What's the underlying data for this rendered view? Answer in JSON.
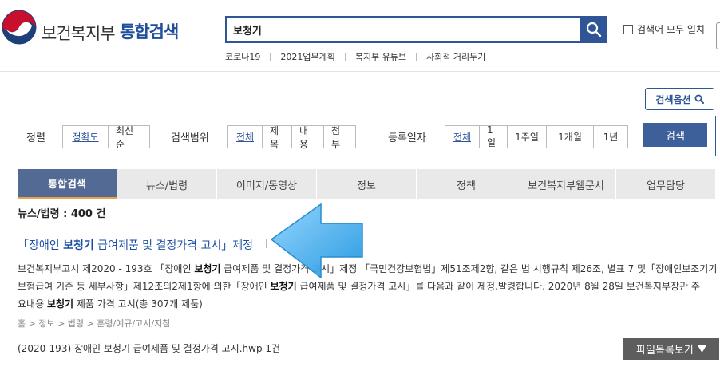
{
  "header": {
    "brand": "보건복지부",
    "service": "통합검색",
    "search_value": "보청기",
    "exact_match_label": "검색어 모두 일치",
    "quicklinks": [
      "코로나19",
      "2021업무계획",
      "복지부 유튜브",
      "사회적 거리두기"
    ]
  },
  "options_button": "검색옵션",
  "filters": {
    "sort_label": "정렬",
    "sort_options": [
      "정확도",
      "최신순"
    ],
    "scope_label": "검색범위",
    "scope_options": [
      "전체",
      "제목",
      "내용",
      "첨부"
    ],
    "date_label": "등록일자",
    "date_options": [
      "전체",
      "1일",
      "1주일",
      "1개월",
      "1년"
    ],
    "search_button": "검색"
  },
  "tabs": [
    "통합검색",
    "뉴스/법령",
    "이미지/동영상",
    "정보",
    "정책",
    "보건복지부웹문서",
    "업무담당"
  ],
  "results": {
    "heading": "뉴스/법령 : 400 건",
    "title_pre": "「장애인 ",
    "title_keyword": "보청기",
    "title_post": " 급여제품 및 결정가격 고시」제정",
    "desc_1a": "보건복지부고시 제2020 - 193호 「장애인 ",
    "desc_1k": "보청기",
    "desc_1b": " 급여제품 및 결정가격 고시」제정 「국민건강보험법」제51조제2항, 같은 법 시행규칙 제26조, 별표 7 및「장애인보조기기",
    "desc_2a": "보험급여 기준 등 세부사항」제12조의2제1항에 의한「장애인 ",
    "desc_2k": "보청기",
    "desc_2b": " 급여제품 및 결정가격 고시」를 다음과 같이 제정.발령합니다. 2020년 8월 28일 보건복지부장관 주",
    "desc_3a": "요내용 ",
    "desc_3k": "보청기",
    "desc_3b": " 제품 가격 고시(총 307개 제품)",
    "breadcrumb": "홈 > 정보 > 법령 > 훈령/예규/고시/지침",
    "file_line": "(2020-193) 장애인 보청기 급여제품 및 결정가격 고시.hwp 1건",
    "file_button": "파일목록보기"
  },
  "colors": {
    "brand_blue": "#2f5597",
    "tab_active": "#536b94",
    "tab_accent": "#e8a34c",
    "arrow": "#3aa6e6"
  }
}
